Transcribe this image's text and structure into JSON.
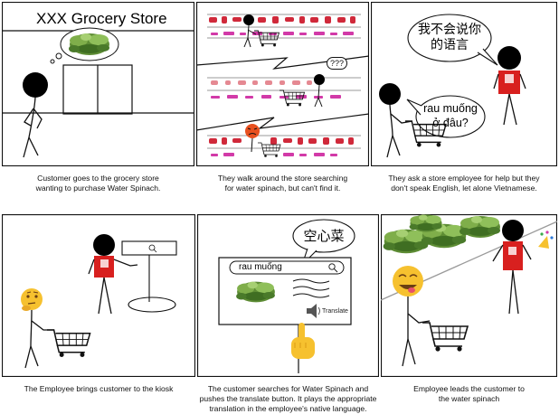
{
  "panel1": {
    "store_sign": "XXX Grocery Store",
    "caption": [
      "Customer goes to the grocery store",
      "wanting to purchase Water Spinach."
    ]
  },
  "panel2": {
    "confused_mark": "???",
    "caption": [
      "They walk around the store searching",
      "for water spinach, but can't find it."
    ]
  },
  "panel3": {
    "employee_bubble": [
      "我不会说你",
      "的语言"
    ],
    "customer_bubble": [
      "rau muống",
      "ở đâu?"
    ],
    "caption": [
      "They ask a store employee for help but they",
      "don't speak English, let alone Vietnamese."
    ]
  },
  "panel4": {
    "caption": [
      "The Employee brings customer to the kiosk"
    ]
  },
  "panel5": {
    "translation_bubble": "空心菜",
    "search_query": "rau muống",
    "translate_button_label": "Translate",
    "caption": [
      "The customer searches for Water Spinach and",
      "pushes the translate button. It plays the appropriate",
      "translation in the employee's native language."
    ]
  },
  "panel6": {
    "caption": [
      "Employee leads the customer to",
      "the water spinach"
    ]
  },
  "colors": {
    "employee_vest": "#d8201f",
    "shelf_red": "#d0293a",
    "shelf_magenta": "#d23aa8",
    "spinach_dark": "#4a7a2a",
    "spinach_light": "#8fbf5a",
    "emoji_yellow": "#f6c12f"
  }
}
